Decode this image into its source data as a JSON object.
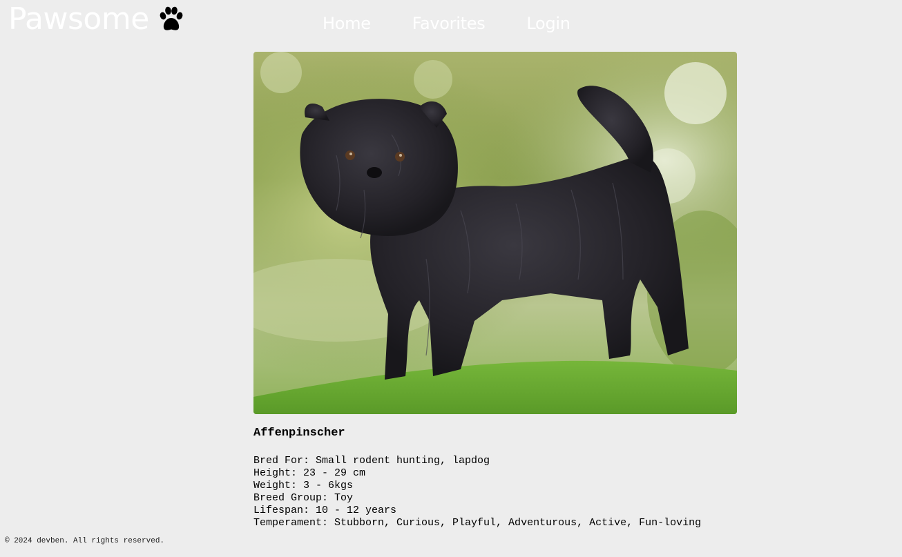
{
  "header": {
    "logo_text": "Pawsome",
    "logo_icon": "paw-icon",
    "nav": [
      {
        "label": "Home"
      },
      {
        "label": "Favorites"
      },
      {
        "label": "Login"
      }
    ]
  },
  "breed": {
    "name": "Affenpinscher",
    "details": [
      "Bred For: Small rodent hunting, lapdog",
      "Height: 23 - 29 cm",
      "Weight: 3 - 6kgs",
      "Breed Group: Toy",
      "Lifespan: 10 - 12 years",
      "Temperament: Stubborn, Curious, Playful, Adventurous, Active, Fun-loving"
    ]
  },
  "footer": {
    "text": "© 2024 devben. All rights reserved."
  },
  "colors": {
    "background": "#ededed",
    "nav_text": "#ffffff",
    "body_text": "#000000"
  }
}
